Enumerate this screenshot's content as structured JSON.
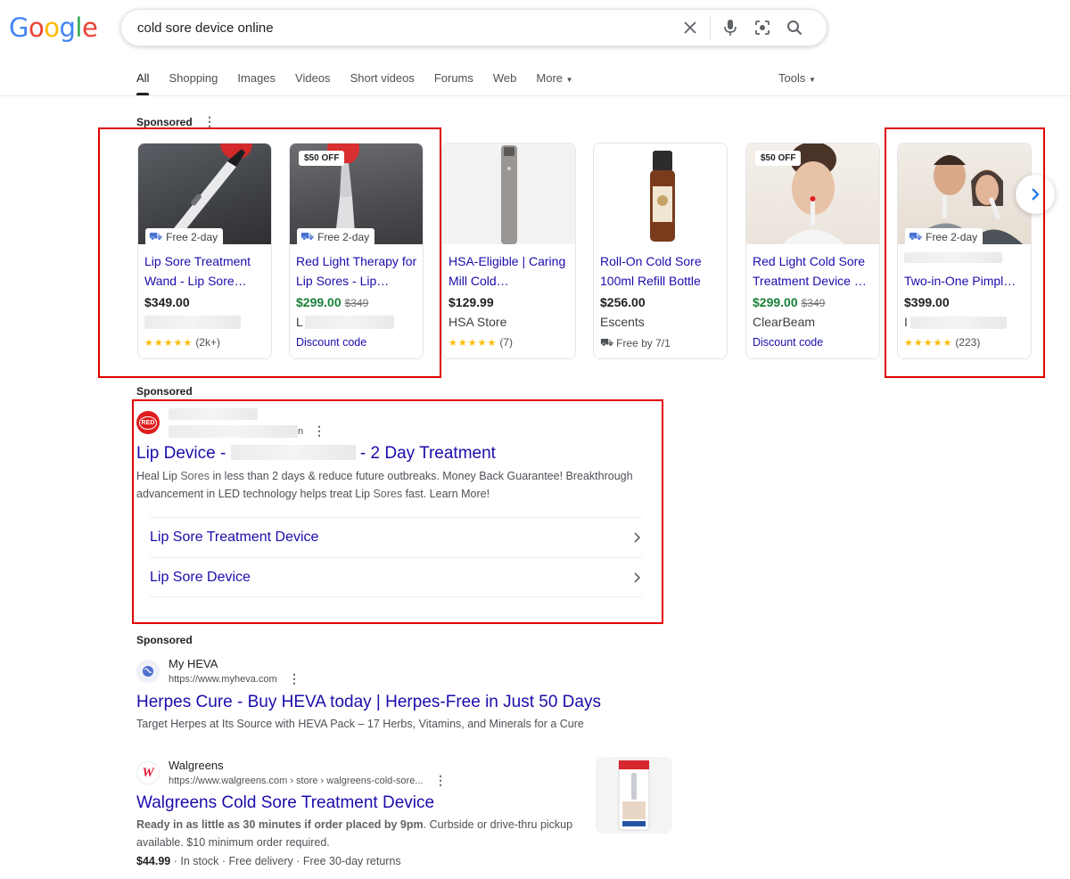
{
  "header": {
    "logo_letters": [
      "G",
      "o",
      "o",
      "g",
      "l",
      "e"
    ],
    "logo_colors": [
      "#4285f4",
      "#ea4335",
      "#fbbc05",
      "#4285f4",
      "#34a853",
      "#ea4335"
    ],
    "query": "cold sore device online",
    "tools_label": "Tools"
  },
  "tabs": [
    {
      "label": "All"
    },
    {
      "label": "Shopping"
    },
    {
      "label": "Images"
    },
    {
      "label": "Videos"
    },
    {
      "label": "Short videos"
    },
    {
      "label": "Forums"
    },
    {
      "label": "Web"
    },
    {
      "label": "More"
    }
  ],
  "shopping": {
    "sponsored_label": "Sponsored",
    "products": [
      {
        "title": "Lip Sore Treatment Wand - Lip Sore…",
        "price": "$349.00",
        "old_price": "",
        "store": "",
        "extra": "(2k+)",
        "stars": "★★★★★",
        "badge": "",
        "shipping": "Free 2-day",
        "image_icon": "red-light-wand-image"
      },
      {
        "title": "Red Light Therapy for Lip Sores - Lip…",
        "price": "$299.00",
        "old_price": "$349",
        "store": "L",
        "extra": "Discount code",
        "stars": "",
        "badge": "$50 OFF",
        "shipping": "Free 2-day",
        "image_icon": "red-light-device-image"
      },
      {
        "title": "HSA-Eligible | Caring Mill Cold…",
        "price": "$129.99",
        "old_price": "",
        "store": "HSA Store",
        "extra": "(7)",
        "stars": "★★★★★",
        "badge": "",
        "shipping": "",
        "image_icon": "silver-device-image"
      },
      {
        "title": "Roll-On Cold Sore 100ml Refill Bottle",
        "price": "$256.00",
        "old_price": "",
        "store": "Escents",
        "extra": "Free by 7/1",
        "stars": "",
        "badge": "",
        "shipping": "",
        "image_icon": "roll-on-bottle-image"
      },
      {
        "title": "Red Light Cold Sore Treatment Device …",
        "price": "$299.00",
        "old_price": "$349",
        "store": "ClearBeam",
        "extra": "Discount code",
        "stars": "",
        "badge": "$50 OFF",
        "shipping": "",
        "image_icon": "woman-device-image"
      },
      {
        "title": "Two-in-One Pimpl…",
        "price": "$399.00",
        "old_price": "",
        "store": "I",
        "extra": "(223)",
        "stars": "★★★★★",
        "badge": "",
        "shipping": "Free 2-day",
        "image_icon": "couple-device-image"
      }
    ]
  },
  "ad1": {
    "sponsored_label": "Sponsored",
    "favicon_text": "RED",
    "url_tail": "n",
    "title_start": "Lip Device -",
    "title_end": "- 2 Day Treatment",
    "desc_1": "Heal Lip ",
    "desc_b1": "Sores",
    "desc_2": " in less than 2 days & reduce future outbreaks. Money Back Guarantee! Breakthrough advancement in LED technology helps treat Lip ",
    "desc_b2": "Sores",
    "desc_3": " fast. Learn More!",
    "sitelinks": [
      "Lip Sore Treatment Device",
      "Lip Sore Device"
    ]
  },
  "ad2": {
    "sponsored_label": "Sponsored",
    "site_name": "My HEVA",
    "url": "https://www.myheva.com",
    "title": "Herpes Cure - Buy HEVA today | Herpes-Free in Just 50 Days",
    "desc": "Target Herpes at Its Source with HEVA Pack – 17 Herbs, Vitamins, and Minerals for a Cure"
  },
  "ad3": {
    "site_name": "Walgreens",
    "favicon_text": "W",
    "url": "https://www.walgreens.com › store › walgreens-cold-sore...",
    "title": "Walgreens Cold Sore Treatment Device",
    "desc_bold": "Ready in as little as 30 minutes if order placed by 9pm",
    "desc_rest": ". Curbside or drive-thru pickup available. $10 minimum order required.",
    "price": "$44.99",
    "meta": " · In stock · Free delivery · Free 30-day returns"
  },
  "colors": {
    "link": "#1a0dab",
    "sale": "#188038",
    "highlight": "#e00000",
    "star": "#fbbc04"
  }
}
